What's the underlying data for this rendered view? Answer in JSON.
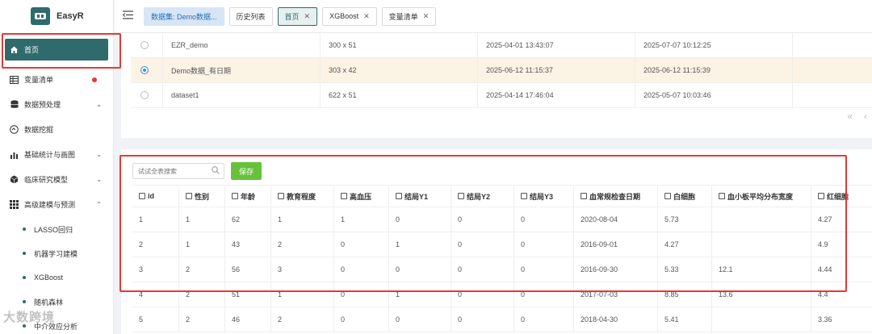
{
  "app": {
    "name": "EasyR"
  },
  "sidebar": {
    "items": [
      {
        "label": "首页",
        "icon": "home-icon",
        "active": true
      },
      {
        "label": "变量清单",
        "icon": "table-icon",
        "badge": "dot"
      },
      {
        "label": "数据预处理",
        "icon": "database-icon",
        "expandable": true
      },
      {
        "label": "数据挖掘",
        "icon": "mining-icon"
      },
      {
        "label": "基础统计与画图",
        "icon": "bar-chart-icon",
        "expandable": true
      },
      {
        "label": "临床研究模型",
        "icon": "cube-icon",
        "expandable": true
      },
      {
        "label": "高级建模与预测",
        "icon": "grid-icon",
        "expandable": true,
        "expanded": true
      }
    ],
    "subitems": [
      "LASSO回归",
      "机器学习建模",
      "XGBoost",
      "随机森林",
      "中介效应分析"
    ]
  },
  "topbar": {
    "tabs": [
      {
        "label": "数据集: Demo数据...",
        "kind": "dataset"
      },
      {
        "label": "历史列表",
        "kind": "plain"
      },
      {
        "label": "首页",
        "kind": "current",
        "closable": true
      },
      {
        "label": "XGBoost",
        "kind": "plain",
        "closable": true
      },
      {
        "label": "变量清单",
        "kind": "plain",
        "closable": true
      }
    ]
  },
  "datasets": {
    "rows": [
      {
        "name": "EZR_demo",
        "size": "300 x 51",
        "created": "2025-04-01 13:43:07",
        "updated": "2025-07-07 10:12:25",
        "selected": false
      },
      {
        "name": "Demo数据_有日期",
        "size": "303 x 42",
        "created": "2025-06-12 11:15:37",
        "updated": "2025-06-12 11:15:39",
        "selected": true
      },
      {
        "name": "dataset1",
        "size": "622 x 51",
        "created": "2025-04-14 17:46:04",
        "updated": "2025-05-07 10:03:46",
        "selected": false
      }
    ],
    "pager": {
      "first": "«",
      "prev": "‹"
    }
  },
  "editor": {
    "search_placeholder": "试试全表搜索",
    "save_label": "保存",
    "columns": [
      "id",
      "性别",
      "年龄",
      "教育程度",
      "高血压",
      "结局Y1",
      "结局Y2",
      "结局Y3",
      "血常规检查日期",
      "白细胞",
      "血小板平均分布宽度",
      "红细胞"
    ],
    "rows": [
      [
        "1",
        "1",
        "62",
        "1",
        "1",
        "0",
        "0",
        "0",
        "2020-08-04",
        "5.73",
        "",
        "4.27"
      ],
      [
        "2",
        "1",
        "43",
        "2",
        "0",
        "1",
        "0",
        "0",
        "2016-09-01",
        "4.27",
        "",
        "4.9"
      ],
      [
        "3",
        "2",
        "56",
        "3",
        "0",
        "0",
        "0",
        "0",
        "2016-09-30",
        "5.33",
        "12.1",
        "4.44"
      ],
      [
        "4",
        "2",
        "51",
        "1",
        "0",
        "1",
        "0",
        "0",
        "2017-07-03",
        "8.85",
        "13.6",
        "4.4"
      ],
      [
        "5",
        "2",
        "46",
        "2",
        "0",
        "0",
        "0",
        "0",
        "2018-04-30",
        "5.41",
        "",
        "3.36"
      ]
    ]
  },
  "watermark": "大数跨境",
  "colors": {
    "brand": "#2f6a6c",
    "save": "#67c23a",
    "highlight": "#e53935"
  }
}
